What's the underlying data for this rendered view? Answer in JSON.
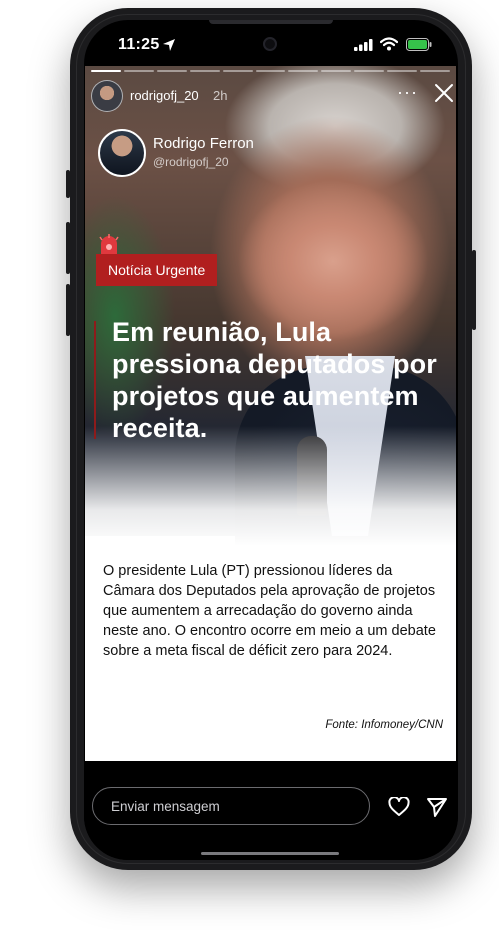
{
  "status_bar": {
    "time": "11:25",
    "icons": [
      "location-arrow-icon",
      "cellular-signal-icon",
      "wifi-icon",
      "battery-icon"
    ],
    "battery_color": "#36c24a"
  },
  "story": {
    "progress_segments": 11,
    "progress_done": 1,
    "username": "rodrigofj_20",
    "age": "2h",
    "more_label": "···",
    "profile": {
      "name": "Rodrigo Ferron",
      "handle": "@rodrigofj_20"
    },
    "tag_label": "Notícia Urgente",
    "headline": "Em reunião, Lula pressiona deputados por projetos que aumentem receita.",
    "body": "O presidente Lula (PT) pressionou líderes da Câmara dos Deputados pela aprovação de projetos que aumentem a arrecadação do governo ainda neste ano. O encontro ocorre em meio a um debate sobre a meta fiscal de déficit zero para 2024.",
    "source": "Fonte: Infomoney/CNN",
    "accent_color": "#b11f1f"
  },
  "reply_bar": {
    "placeholder": "Enviar mensagem",
    "icons": [
      "heart-icon",
      "send-icon"
    ]
  }
}
